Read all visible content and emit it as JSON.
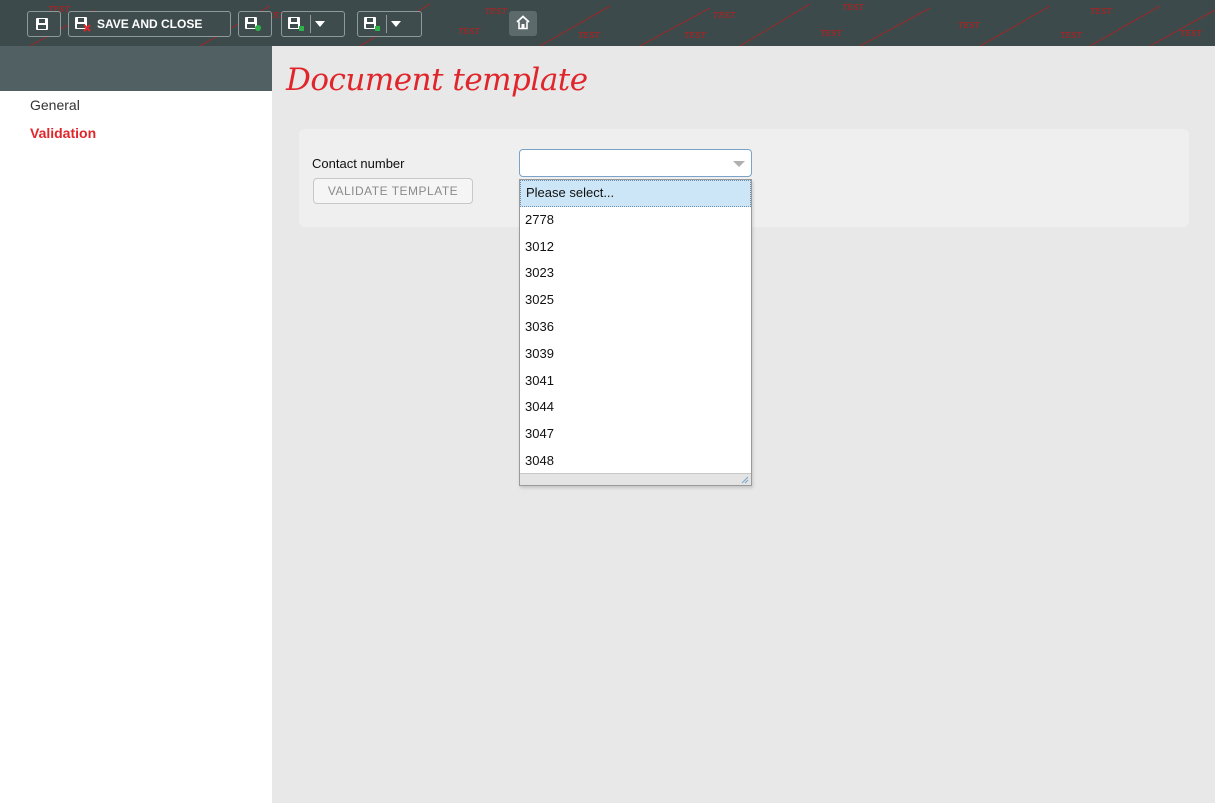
{
  "toolbar": {
    "save_and_close_label": "SAVE AND CLOSE",
    "watermark_text": "TEST",
    "colors": {
      "background": "#3c4a4b",
      "watermark": "#c21b1b"
    },
    "icons": [
      "save-icon",
      "save-close-icon",
      "save-add-icon",
      "save-dropdown-icon",
      "save-next-icon",
      "home-icon"
    ]
  },
  "sidebar": {
    "items": [
      {
        "label": "General",
        "active": false
      },
      {
        "label": "Validation",
        "active": true
      }
    ]
  },
  "main": {
    "title": "Document template",
    "form": {
      "contact_label": "Contact number",
      "contact_value": "",
      "validate_label": "VALIDATE TEMPLATE"
    },
    "dropdown": {
      "options": [
        "Please select...",
        "2778",
        "3012",
        "3023",
        "3025",
        "3036",
        "3039",
        "3041",
        "3044",
        "3047",
        "3048"
      ],
      "highlighted": "Please select..."
    }
  },
  "colors": {
    "accent": "#e0262b",
    "sidebar_header": "#516163",
    "highlight": "#cde6f7"
  }
}
